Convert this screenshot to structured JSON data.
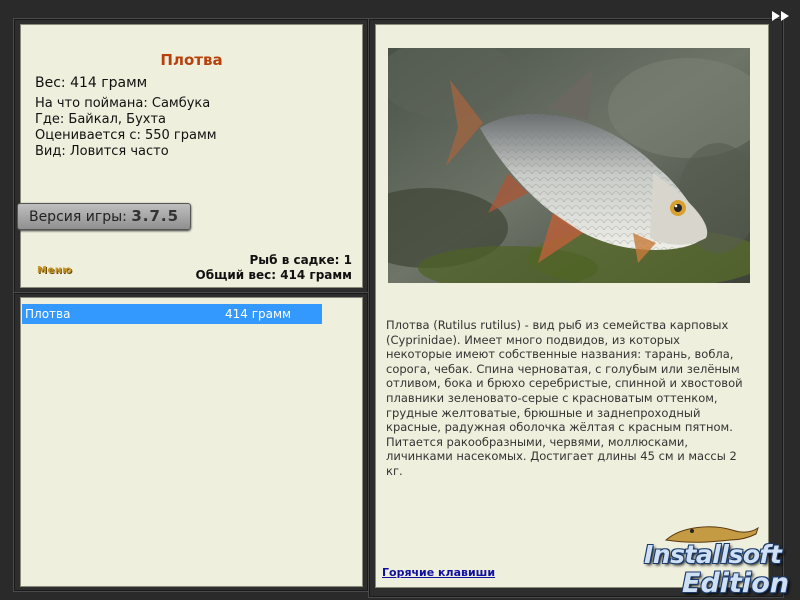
{
  "fish_info": {
    "name": "Плотва",
    "weight": "Вес: 414 грамм",
    "caught_on": "На что поймана: Самбука",
    "location": "Где: Байкал, Бухта",
    "rated_from": "Оценивается с: 550 грамм",
    "frequency": "Вид: Ловится часто"
  },
  "version": {
    "label": "Версия игры:",
    "number": "3.7.5"
  },
  "menu_label": "Меню",
  "keepnet": {
    "fish_count": "Рыб в садке: 1",
    "total_weight": "Общий вес: 414 грамм"
  },
  "catch_list": [
    {
      "name": "Плотва",
      "weight": "414 грамм"
    }
  ],
  "description": "Плотва (Rutilus rutilus) - вид рыб из семейства карповых (Cyprinidae). Имеет много подвидов, из которых некоторые имеют собственные названия: тарань, вобла, сорога, чебак. Спина черноватая, с голубым или зелёным отливом, бока и брюхо серебристые, спинной и хвостовой плавники зеленовато-серые с красноватым оттенком, грудные желтоватые, брюшные и заднепроходный красные, радужная оболочка жёлтая с красным пятном. Питается ракообразными, червями, моллюсками, личинками насекомых. Достигает длины 45 см и массы 2 кг.",
  "hotkeys_link": "Горячие клавиши",
  "watermark": {
    "line1": "Installsoft",
    "line2": "Edition"
  },
  "icons": {
    "next": "double-chevron-right-icon"
  },
  "colors": {
    "panel_bg": "#efefde",
    "title": "#b8400a",
    "selection": "#3399ff",
    "link": "#1010a0"
  }
}
